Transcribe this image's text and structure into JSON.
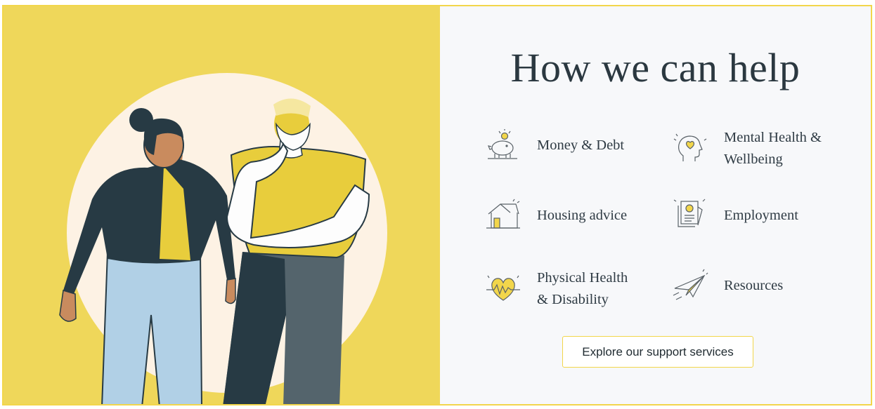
{
  "section": {
    "title": "How we can help",
    "illustration": "two-people-illustration",
    "colors": {
      "accent_yellow": "#efd75a",
      "border_yellow": "#f2d64b",
      "text_dark": "#2b3840",
      "panel_bg": "#f7f8fa"
    }
  },
  "services": [
    {
      "label": "Money & Debt",
      "icon": "piggy-bank-icon"
    },
    {
      "label": "Mental Health &\nWellbeing",
      "icon": "head-heart-icon"
    },
    {
      "label": "Housing advice",
      "icon": "house-icon"
    },
    {
      "label": "Employment",
      "icon": "document-badge-icon"
    },
    {
      "label": "Physical Health\n& Disability",
      "icon": "heartbeat-icon"
    },
    {
      "label": "Resources",
      "icon": "paper-plane-icon"
    }
  ],
  "cta": {
    "label": "Explore our support services"
  }
}
